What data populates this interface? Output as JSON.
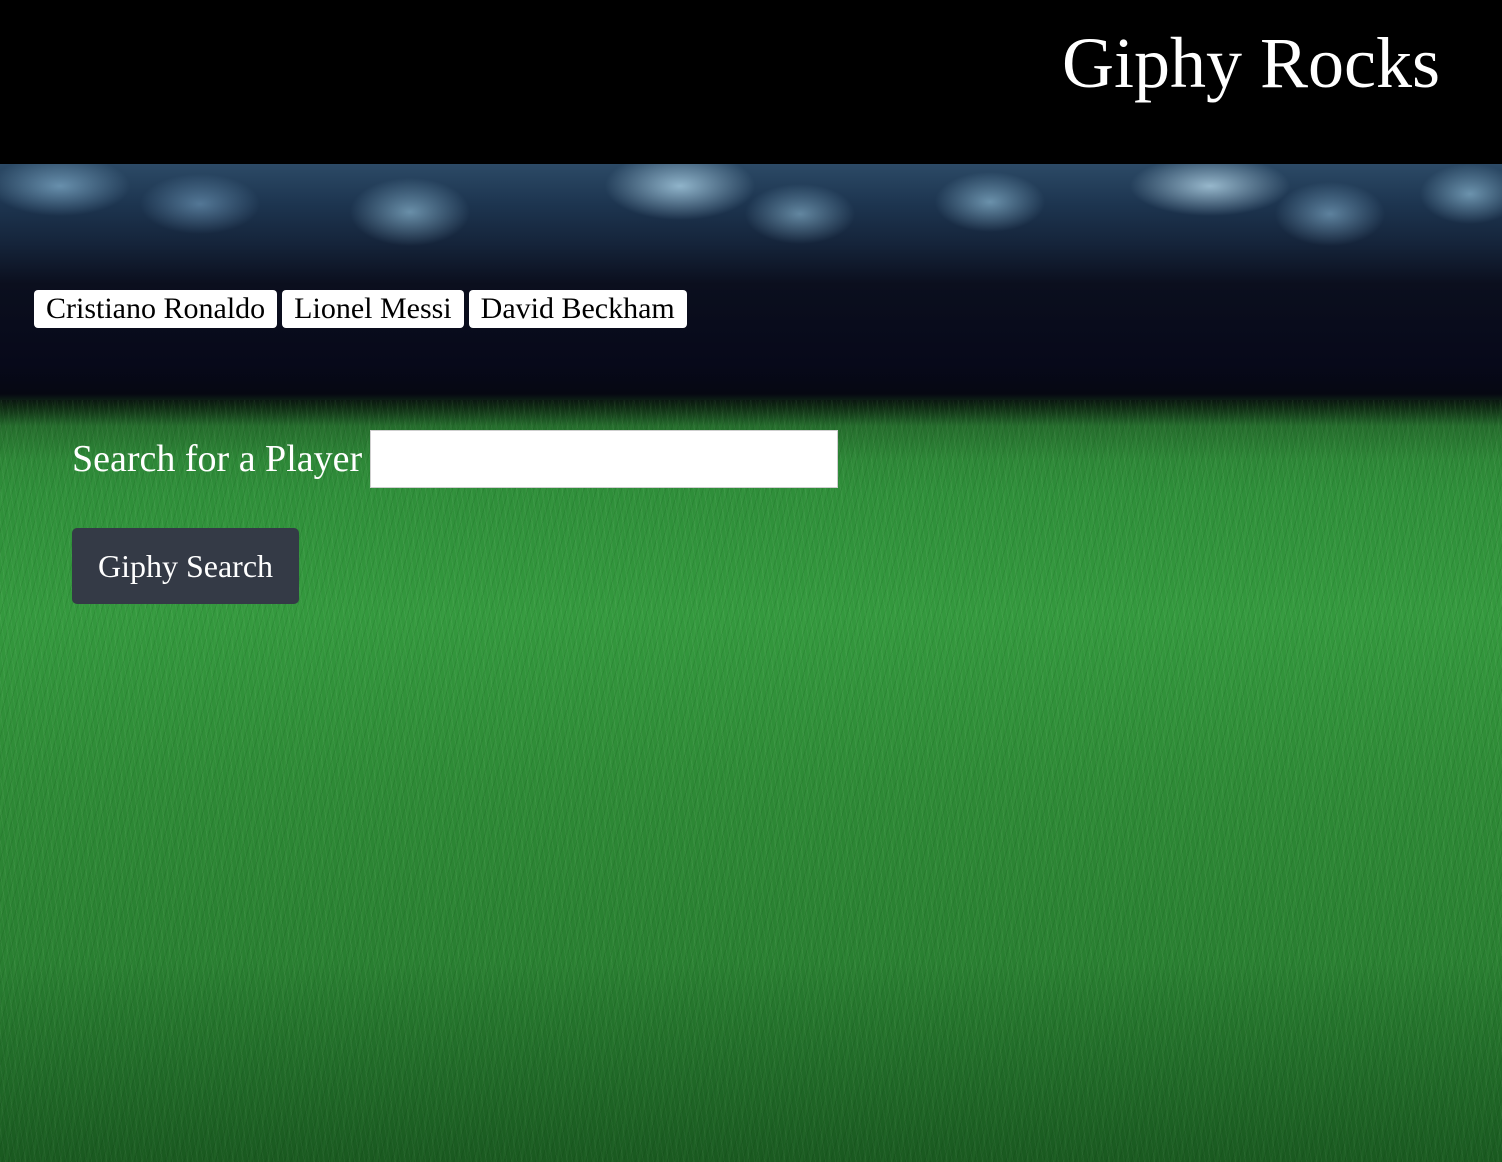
{
  "header": {
    "title": "Giphy Rocks"
  },
  "players": [
    {
      "label": "Cristiano Ronaldo"
    },
    {
      "label": "Lionel Messi"
    },
    {
      "label": "David Beckham"
    }
  ],
  "search": {
    "label": "Search for a Player",
    "value": "",
    "placeholder": "",
    "button_label": "Giphy Search"
  },
  "colors": {
    "header_background": "#000000",
    "title_text": "#ffffff",
    "player_button_background": "#ffffff",
    "search_button_background": "#343a46",
    "grass_green": "#2f8f3a"
  }
}
